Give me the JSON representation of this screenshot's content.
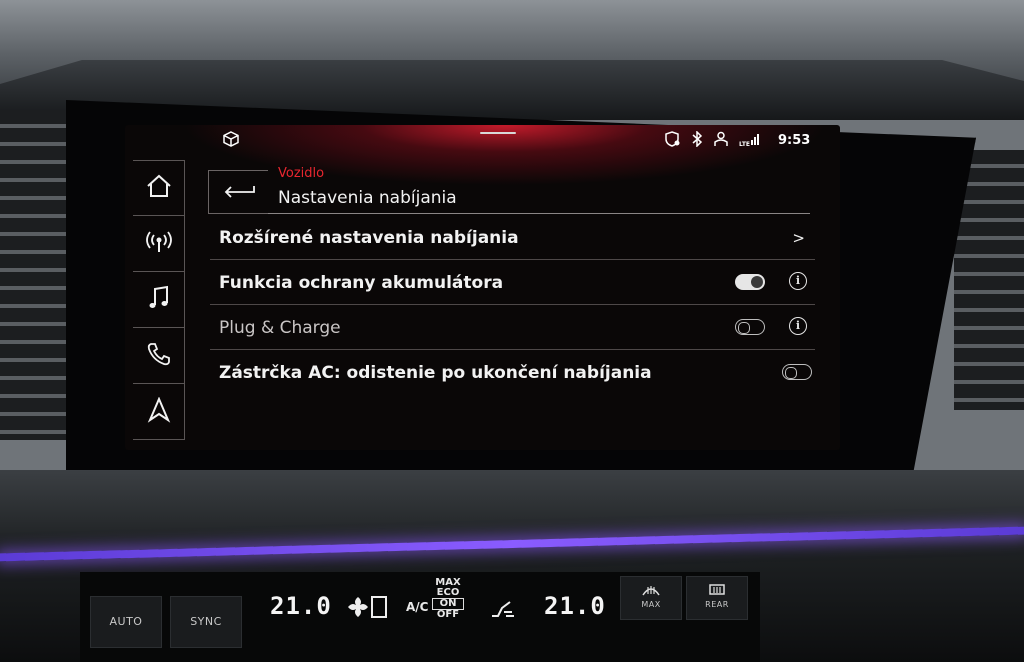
{
  "status": {
    "time": "9:53",
    "icons": [
      "cube-icon",
      "shield-location-icon",
      "bluetooth-icon",
      "user-icon",
      "lte-signal-icon"
    ]
  },
  "sidebar": {
    "items": [
      {
        "icon": "home-icon"
      },
      {
        "icon": "radio-icon"
      },
      {
        "icon": "music-icon"
      },
      {
        "icon": "phone-icon"
      },
      {
        "icon": "navigation-icon"
      }
    ]
  },
  "header": {
    "breadcrumb": "Vozidlo",
    "title": "Nastavenia nabíjania"
  },
  "settings": [
    {
      "label": "Rozšírené nastavenia nabíjania",
      "control": "chevron",
      "chevron": ">"
    },
    {
      "label": "Funkcia ochrany akumulátora",
      "control": "toggle",
      "state": "on",
      "info": "i"
    },
    {
      "label": "Plug & Charge",
      "control": "toggle",
      "state": "off",
      "info": "i"
    },
    {
      "label": "Zástrčka AC: odistenie po ukončení nabíjania",
      "control": "toggle",
      "state": "off"
    }
  ],
  "climate": {
    "auto": "AUTO",
    "sync": "SYNC",
    "temp_left": "21.0",
    "temp_right": "21.0",
    "ac": "A/C",
    "max": "MAX",
    "eco": "ECO",
    "on": "ON",
    "off": "OFF",
    "front_defrost": "MAX",
    "rear_defrost": "REAR"
  },
  "colors": {
    "accent": "#e8262f",
    "screen_bg": "#0a0707",
    "ambient": "#8a5cff"
  }
}
